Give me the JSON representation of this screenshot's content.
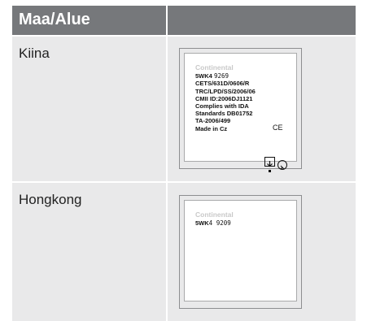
{
  "table": {
    "header": {
      "col1": "Maa/Alue",
      "col2": ""
    },
    "rows": [
      {
        "country": "Kiina",
        "label": {
          "brand": "Continental",
          "model_bold": "5WK4",
          "model_num": "9269",
          "lines": [
            "CETS/631D/0606/R",
            "TRC/LPD/SS/2006/06",
            "CMII ID:2006DJ1121",
            "Complies with IDA",
            "Standards DB01752",
            "TA-2006/499",
            "Made in Cz"
          ],
          "ce_mark": "CE"
        }
      },
      {
        "country": "Hongkong",
        "label": {
          "brand": "Continental",
          "model_bold": "5WK",
          "model_num": "4 9209"
        }
      }
    ]
  }
}
